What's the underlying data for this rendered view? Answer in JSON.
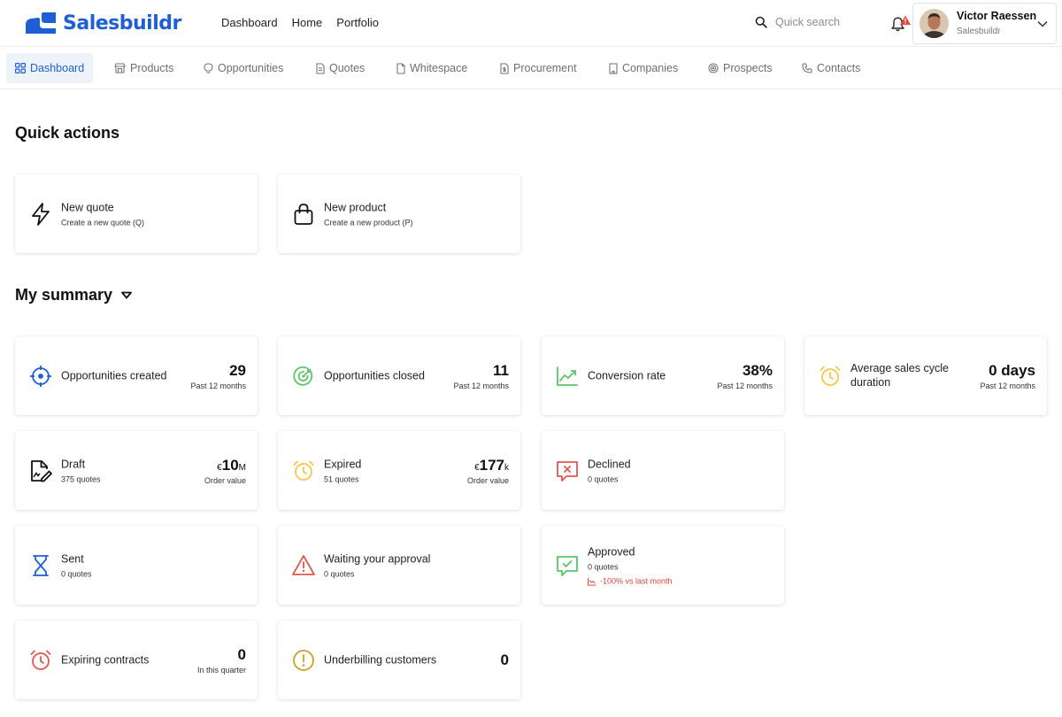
{
  "brand": {
    "name": "Salesbuildr",
    "color": "#1f5fd6"
  },
  "topnav": {
    "items": [
      "Dashboard",
      "Home",
      "Portfolio"
    ]
  },
  "search": {
    "placeholder": "Quick search"
  },
  "user": {
    "name": "Victor Raessen",
    "org": "Salesbuildr"
  },
  "subnav": {
    "items": [
      {
        "label": "Dashboard",
        "icon": "grid-icon"
      },
      {
        "label": "Products",
        "icon": "store-icon"
      },
      {
        "label": "Opportunities",
        "icon": "lightbulb-icon"
      },
      {
        "label": "Quotes",
        "icon": "document-icon"
      },
      {
        "label": "Whitespace",
        "icon": "file-icon"
      },
      {
        "label": "Procurement",
        "icon": "file-dollar-icon"
      },
      {
        "label": "Companies",
        "icon": "building-icon"
      },
      {
        "label": "Prospects",
        "icon": "target-icon"
      },
      {
        "label": "Contacts",
        "icon": "phone-icon"
      }
    ]
  },
  "quick_actions": {
    "heading": "Quick actions",
    "items": [
      {
        "title": "New quote",
        "subtitle": "Create a new quote (Q)",
        "icon": "lightning-icon"
      },
      {
        "title": "New product",
        "subtitle": "Create a new product (P)",
        "icon": "shopping-bag-icon"
      }
    ]
  },
  "summary": {
    "heading": "My summary",
    "opportunities_created": {
      "title": "Opportunities created",
      "value": "29",
      "caption": "Past 12 months"
    },
    "opportunities_closed": {
      "title": "Opportunities closed",
      "value": "11",
      "caption": "Past 12 months"
    },
    "conversion_rate": {
      "title": "Conversion rate",
      "value": "38%",
      "caption": "Past 12 months"
    },
    "avg_cycle": {
      "title": "Average sales cycle duration",
      "value": "0 days",
      "caption": "Past 12 months"
    },
    "draft": {
      "title": "Draft",
      "sub": "375 quotes",
      "value_prefix": "€",
      "value": "10",
      "value_suffix": "M",
      "caption": "Order value"
    },
    "expired": {
      "title": "Expired",
      "sub": "51 quotes",
      "value_prefix": "€",
      "value": "177",
      "value_suffix": "k",
      "caption": "Order value"
    },
    "declined": {
      "title": "Declined",
      "sub": "0 quotes"
    },
    "sent": {
      "title": "Sent",
      "sub": "0 quotes"
    },
    "waiting": {
      "title": "Waiting your approval",
      "sub": "0 quotes"
    },
    "approved": {
      "title": "Approved",
      "sub": "0 quotes",
      "trend": "-100% vs last month"
    },
    "expiring_contracts": {
      "title": "Expiring contracts",
      "value": "0",
      "caption": "In this quarter"
    },
    "underbilling": {
      "title": "Underbilling customers",
      "value": "0"
    }
  },
  "colors": {
    "blue": "#1f5fd6",
    "green": "#5cc46b",
    "yellow": "#f2c94c",
    "red": "#e0574f",
    "gold": "#c9a227"
  }
}
